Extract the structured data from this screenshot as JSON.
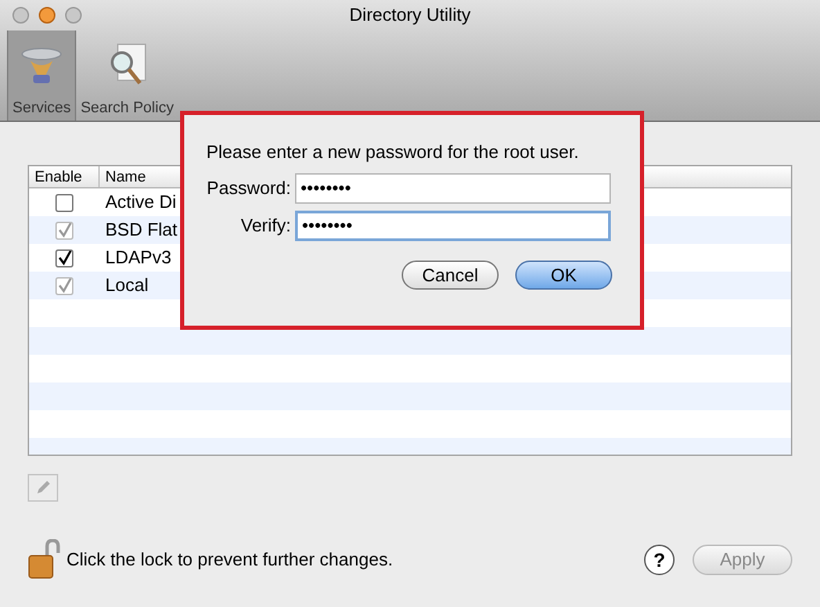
{
  "window": {
    "title": "Directory Utility"
  },
  "toolbar": [
    {
      "label": "Services",
      "selected": true,
      "kind": "services"
    },
    {
      "label": "Search Policy",
      "selected": false,
      "kind": "search"
    }
  ],
  "table": {
    "columns": [
      "Enable",
      "Name"
    ],
    "rows": [
      {
        "name": "Active Di",
        "checked": false,
        "disabled": false
      },
      {
        "name": "BSD Flat",
        "checked": true,
        "disabled": true
      },
      {
        "name": "LDAPv3",
        "checked": true,
        "disabled": false
      },
      {
        "name": "Local",
        "checked": true,
        "disabled": true
      }
    ]
  },
  "sheet": {
    "message": "Please enter a new password for the root user.",
    "fields": [
      {
        "label": "Password:",
        "value": "••••••••",
        "focused": false
      },
      {
        "label": "Verify:",
        "value": "••••••••",
        "focused": true
      }
    ],
    "buttons": [
      {
        "label": "Cancel",
        "default": false
      },
      {
        "label": "OK",
        "default": true
      }
    ]
  },
  "lock": {
    "text": "Click the lock to prevent further changes."
  },
  "help": {
    "label": "?"
  },
  "apply": {
    "label": "Apply",
    "disabled": true
  }
}
